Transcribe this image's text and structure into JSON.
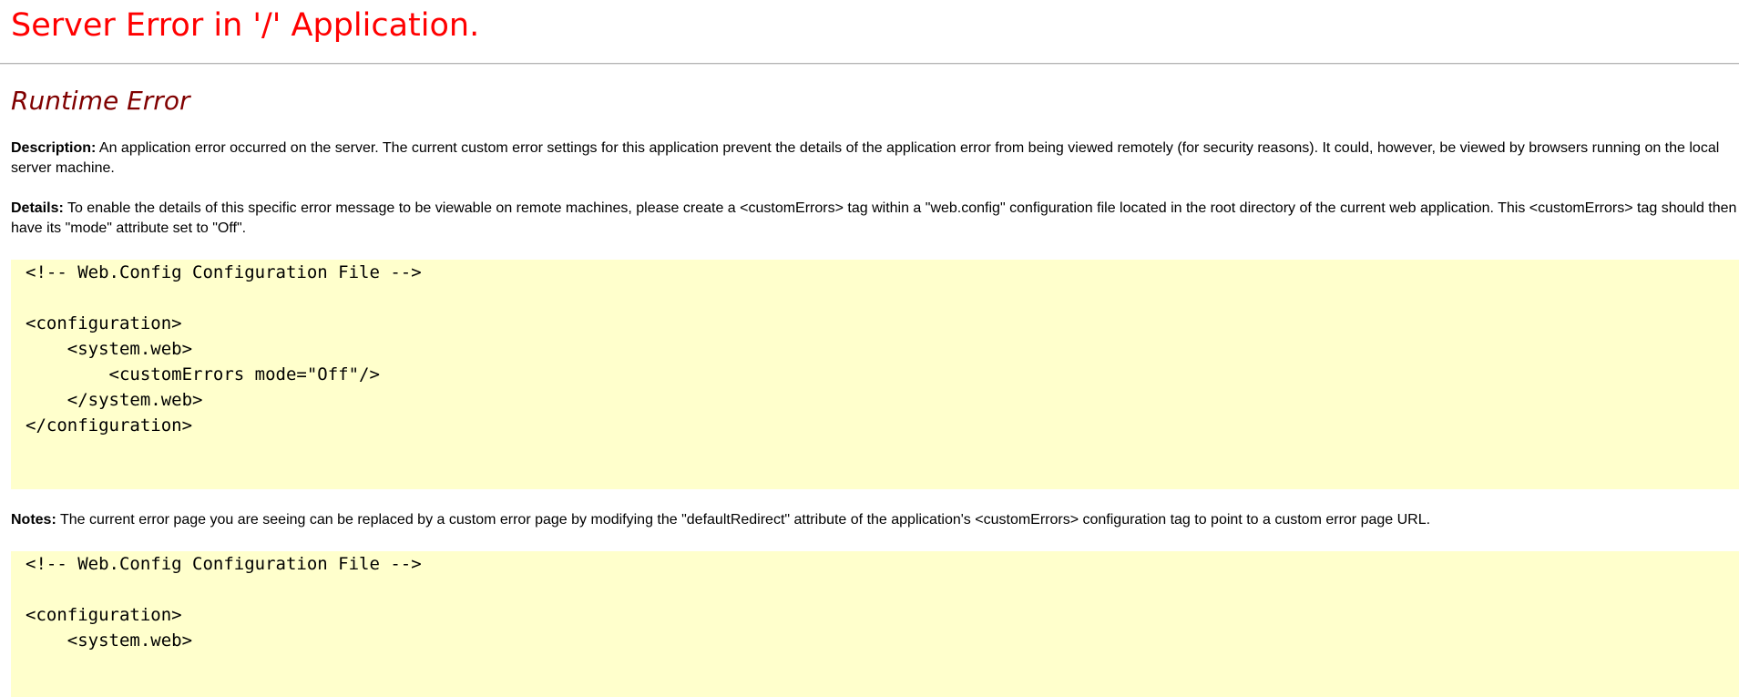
{
  "header": {
    "title": "Server Error in '/' Application.",
    "subtitle": "Runtime Error"
  },
  "description": {
    "label": "Description:",
    "text": " An application error occurred on the server. The current custom error settings for this application prevent the details of the application error from being viewed remotely (for security reasons). It could, however, be viewed by browsers running on the local server machine."
  },
  "details": {
    "label": "Details:",
    "text": " To enable the details of this specific error message to be viewable on remote machines, please create a <customErrors> tag within a \"web.config\" configuration file located in the root directory of the current web application. This <customErrors> tag should then have its \"mode\" attribute set to \"Off\"."
  },
  "code_block_1": "<!-- Web.Config Configuration File -->\n\n<configuration>\n    <system.web>\n        <customErrors mode=\"Off\"/>\n    </system.web>\n</configuration>",
  "notes": {
    "label": "Notes:",
    "text": " The current error page you are seeing can be replaced by a custom error page by modifying the \"defaultRedirect\" attribute of the application's <customErrors> configuration tag to point to a custom error page URL."
  },
  "code_block_2": "<!-- Web.Config Configuration File -->\n\n<configuration>\n    <system.web>",
  "colors": {
    "title": "#ff0000",
    "subtitle": "#800000",
    "code_background": "#ffffcc"
  }
}
